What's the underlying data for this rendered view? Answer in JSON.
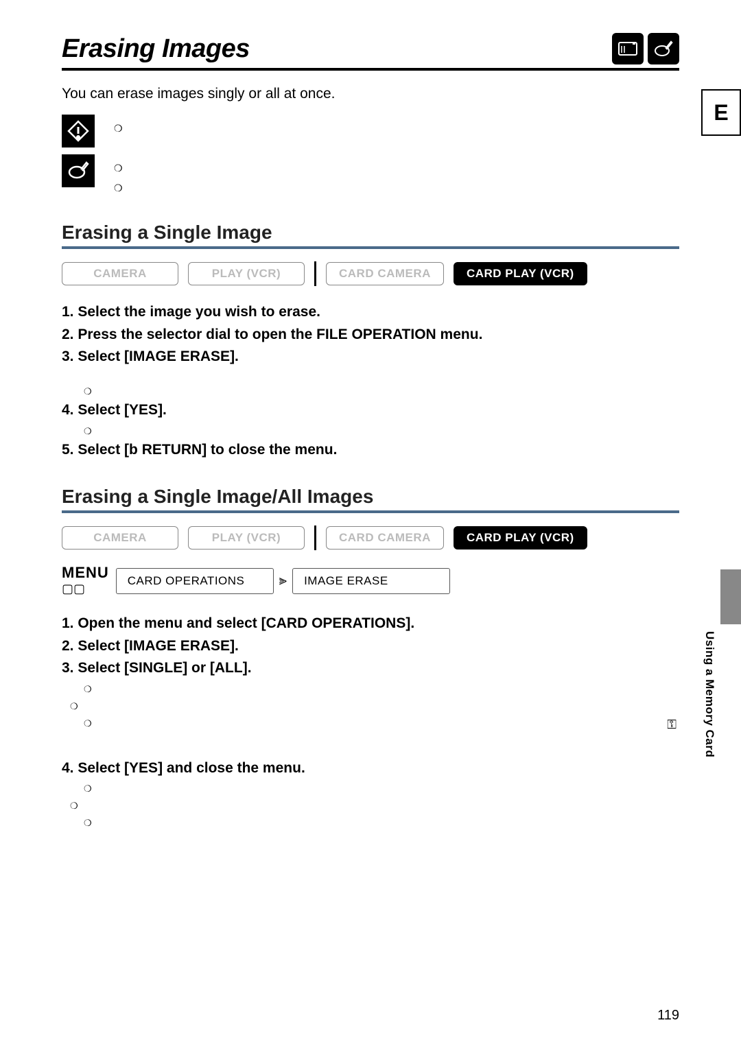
{
  "title": "Erasing Images",
  "intro": "You can erase images singly or all at once.",
  "section1": {
    "heading": "Erasing a Single Image",
    "modes": [
      "CAMERA",
      "PLAY (VCR)",
      "CARD CAMERA",
      "CARD PLAY (VCR)"
    ],
    "steps": {
      "s1": "1. Select the image you wish to erase.",
      "s2": "2. Press the selector dial to open the FILE OPERATION menu.",
      "s3": "3. Select [IMAGE ERASE].",
      "s4": "4. Select [YES].",
      "s5": "5. Select [b  RETURN] to close the menu."
    }
  },
  "section2": {
    "heading": "Erasing a Single Image/All Images",
    "modes": [
      "CAMERA",
      "PLAY (VCR)",
      "CARD CAMERA",
      "CARD PLAY (VCR)"
    ],
    "menu_label": "MENU",
    "menu_box1": "CARD OPERATIONS",
    "menu_box2": "IMAGE ERASE",
    "steps": {
      "s1": "1. Open the menu and select [CARD OPERATIONS].",
      "s2": "2. Select [IMAGE ERASE].",
      "s3": "3. Select [SINGLE] or [ALL].",
      "s4": "4. Select [YES] and close the menu."
    }
  },
  "side_tab": "E",
  "side_text_bold": "Using a Memory Card",
  "page_number": "119"
}
